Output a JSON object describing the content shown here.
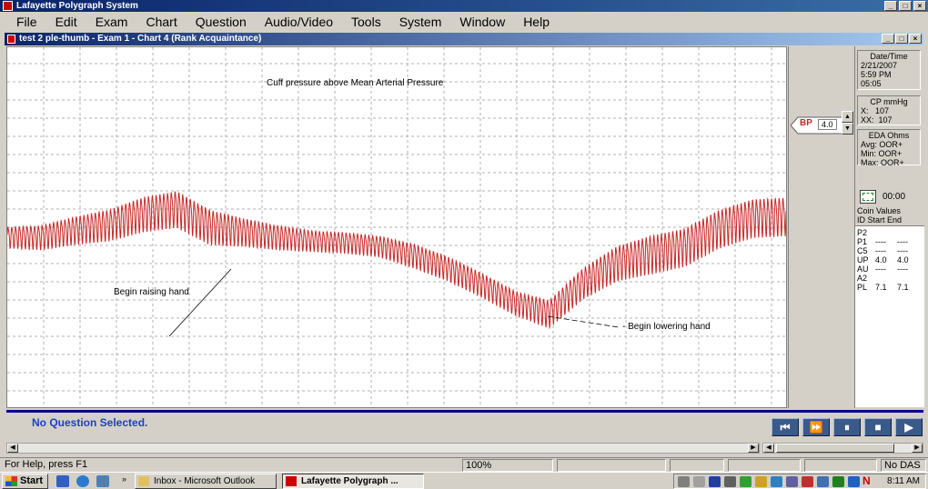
{
  "app": {
    "title": "Lafayette Polygraph System",
    "window_buttons": [
      "_",
      "□",
      "×"
    ]
  },
  "menu": [
    "File",
    "Edit",
    "Exam",
    "Chart",
    "Question",
    "Audio/Video",
    "Tools",
    "System",
    "Window",
    "Help"
  ],
  "chart_window": {
    "title": "test 2 ple-thumb - Exam 1 - Chart 4 (Rank Acquaintance)",
    "window_buttons": [
      "_",
      "□",
      "×"
    ]
  },
  "annotations": {
    "cuff": "Cuff pressure above Mean Arterial Pressure",
    "raise": "Begin raising hand",
    "lower": "- Begin lowering hand"
  },
  "channel": {
    "label": "BP",
    "value": "4.0",
    "color": "#c82828"
  },
  "side": {
    "datetime": {
      "title": "Date/Time",
      "date": "2/21/2007",
      "time": "5:59 PM",
      "elapsed": "05:05"
    },
    "cp": {
      "title": "CP mmHg",
      "x_label": "X:",
      "x_value": "107",
      "xx_label": "XX:",
      "xx_value": "107"
    },
    "eda": {
      "title": "EDA Ohms",
      "avg_label": "Avg:",
      "avg_value": "OOR+",
      "min_label": "Min:",
      "min_value": "OOR+",
      "max_label": "Max:",
      "max_value": "OOR+"
    },
    "timer": "00:00",
    "coin_values_label": "Coin Values",
    "table_header": "ID  Start  End",
    "rows": [
      {
        "id": "P2",
        "start": "",
        "end": ""
      },
      {
        "id": "P1",
        "start": "----",
        "end": "----"
      },
      {
        "id": "C5",
        "start": "----",
        "end": "----"
      },
      {
        "id": "UP",
        "start": "4.0",
        "end": "4.0"
      },
      {
        "id": "AU",
        "start": "----",
        "end": "----"
      },
      {
        "id": "A2",
        "start": "",
        "end": ""
      },
      {
        "id": "PL",
        "start": "7.1",
        "end": "7.1"
      }
    ]
  },
  "question_status": "No Question Selected.",
  "transport": [
    "⏮",
    "⏩",
    "⏸",
    "■",
    "▶"
  ],
  "statusbar": {
    "help": "For Help, press F1",
    "zoom": "100%",
    "das": "No DAS"
  },
  "taskbar": {
    "start": "Start",
    "tasks": [
      "Inbox - Microsoft Outlook",
      "Lafayette Polygraph ..."
    ],
    "clock": "8:11 AM",
    "tray_letter": "N"
  },
  "chart_data": {
    "type": "line",
    "series": [
      {
        "amplitude_trend": [
          12,
          14,
          16,
          18,
          20,
          21,
          20,
          16,
          14,
          12,
          12,
          12,
          14,
          14,
          14,
          14,
          16,
          18,
          20,
          22,
          22,
          22,
          22,
          22
        ],
        "baseline_trend": [
          0,
          0,
          8,
          14,
          26,
          32,
          12,
          6,
          0,
          -4,
          -6,
          -10,
          -20,
          -34,
          -52,
          -72,
          -84,
          -50,
          -28,
          -18,
          -10,
          10,
          22,
          24
        ]
      }
    ],
    "cycles": 205,
    "grid": true
  }
}
